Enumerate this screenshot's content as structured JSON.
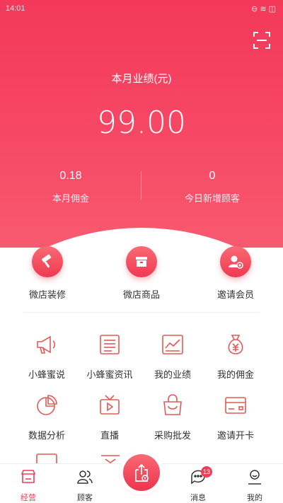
{
  "status_bar": {
    "time": "14:01",
    "icons": "⊖ ≋ ◫"
  },
  "header": {
    "scan_icon": "scan-icon"
  },
  "performance": {
    "label": "本月业绩(元)",
    "value": "99.00"
  },
  "stats": [
    {
      "value": "0.18",
      "label": "本月佣金"
    },
    {
      "value": "0",
      "label": "今日新增顾客"
    }
  ],
  "top_actions": [
    {
      "label": "微店装修",
      "icon": "paint-roller-icon"
    },
    {
      "label": "微店商品",
      "icon": "box-icon"
    },
    {
      "label": "邀请会员",
      "icon": "add-user-icon"
    }
  ],
  "grid": [
    {
      "label": "小蜂蜜说",
      "icon": "megaphone-icon"
    },
    {
      "label": "小蜂蜜资讯",
      "icon": "news-icon"
    },
    {
      "label": "我的业绩",
      "icon": "chart-icon"
    },
    {
      "label": "我的佣金",
      "icon": "money-bag-icon"
    },
    {
      "label": "数据分析",
      "icon": "pie-chart-icon"
    },
    {
      "label": "直播",
      "icon": "tv-icon"
    },
    {
      "label": "采购批发",
      "icon": "shopping-bag-icon"
    },
    {
      "label": "邀请开卡",
      "icon": "card-icon"
    }
  ],
  "tabbar": {
    "items": [
      {
        "label": "经营",
        "icon": "store-icon",
        "active": true
      },
      {
        "label": "顾客",
        "icon": "users-icon"
      },
      {
        "label": "消息",
        "icon": "chat-icon",
        "badge": "13"
      },
      {
        "label": "我的",
        "icon": "profile-icon"
      }
    ],
    "center_icon": "share-bag-icon"
  },
  "colors": {
    "primary": "#f23d56",
    "hero_top": "#f4385a",
    "hero_bottom": "#f85a6f"
  }
}
